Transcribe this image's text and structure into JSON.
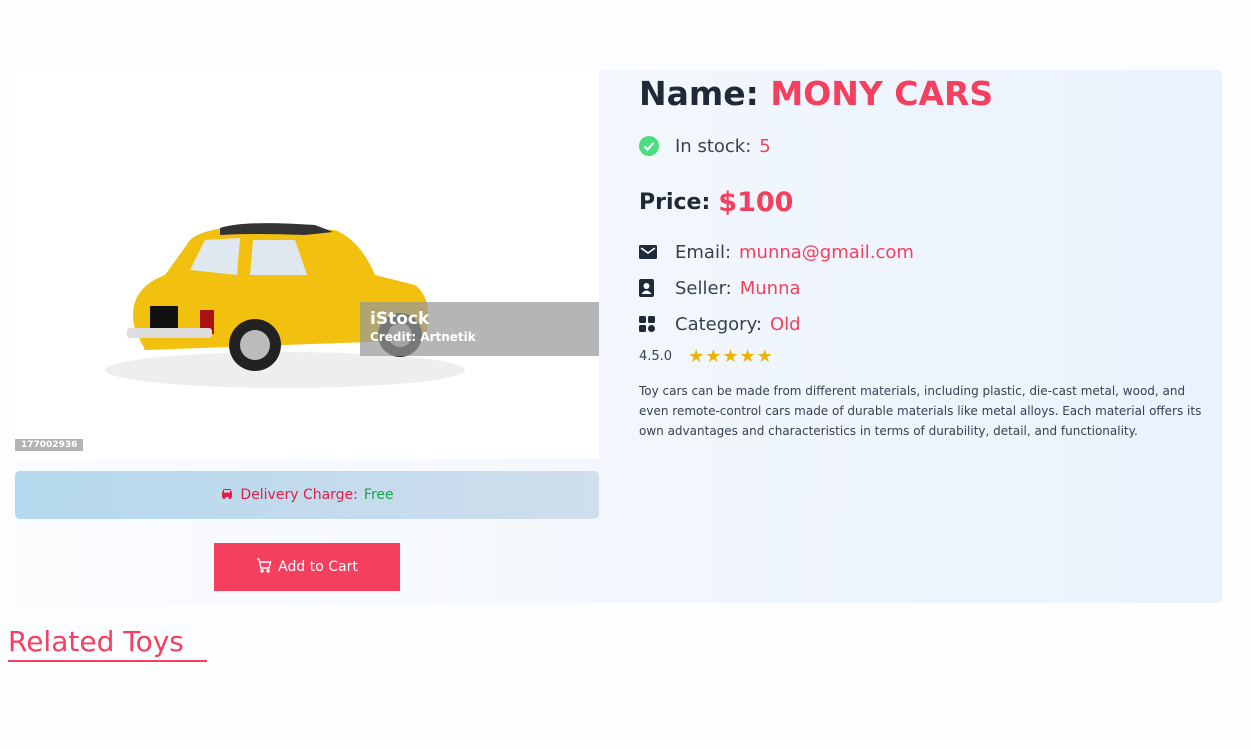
{
  "product": {
    "name_label": "Name:",
    "name": "MONY CARS",
    "stock_label": "In stock:",
    "stock": "5",
    "price_label": "Price:",
    "price": "$100",
    "email_label": "Email:",
    "email": "munna@gmail.com",
    "seller_label": "Seller:",
    "seller": "Munna",
    "category_label": "Category:",
    "category": "Old",
    "rating_text": "4.5.0",
    "rating": 4.5,
    "stars": "★★★★★",
    "description": "Toy cars can be made from different materials, including plastic, die-cast metal, wood, and even remote-control cars made of durable materials like metal alloys. Each material offers its own advantages and characteristics in terms of durability, detail, and functionality."
  },
  "image": {
    "watermark_brand": "iStock",
    "watermark_credit": "Credit: Artnetik",
    "image_id": "177002936"
  },
  "delivery": {
    "label": "Delivery Charge:",
    "value": "Free"
  },
  "cart_button": "Add to Cart",
  "related_heading": "Related Toys",
  "colors": {
    "accent": "#f43f5e",
    "success": "#16a34a",
    "star": "#eab308"
  }
}
